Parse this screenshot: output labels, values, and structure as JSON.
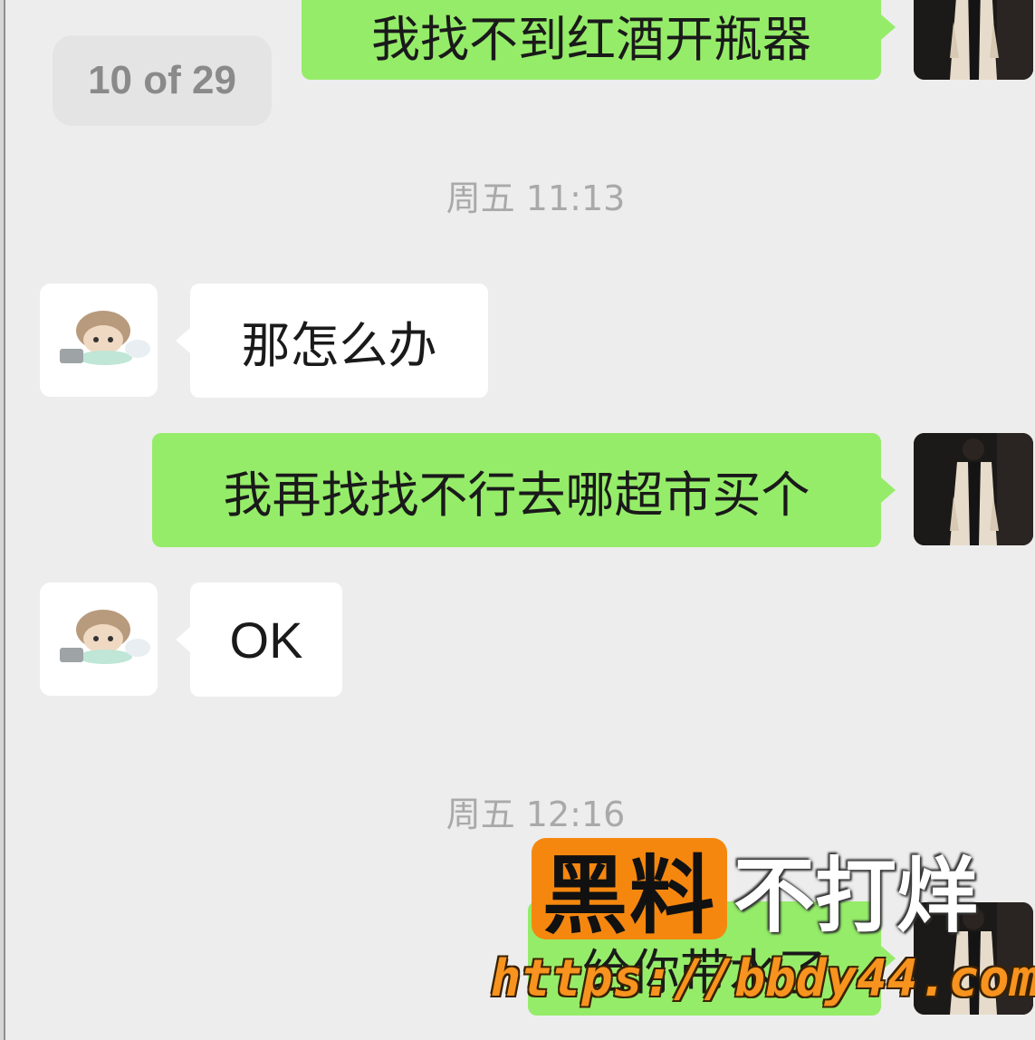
{
  "pager": {
    "label": "10 of 29"
  },
  "timestamps": [
    "周五 11:13",
    "周五 12:16"
  ],
  "messages": [
    {
      "side": "right",
      "text": "我找不到红酒开瓶器"
    },
    {
      "side": "left",
      "text": "那怎么办"
    },
    {
      "side": "right",
      "text": "我再找找不行去哪超市买个"
    },
    {
      "side": "left",
      "text": "OK"
    },
    {
      "side": "right",
      "text": "给你带水了"
    }
  ],
  "watermark": {
    "brand_highlight": "黑料",
    "brand_rest": "不打烊",
    "url": "https://bbdy44.com"
  },
  "colors": {
    "background": "#ededed",
    "sent_bubble": "#95ec69",
    "received_bubble": "#ffffff",
    "timestamp_text": "#a9a9a9",
    "watermark_orange": "#f5870f"
  },
  "icons": {
    "friend_avatar": "cartoon-avatar-icon",
    "my_avatar": "person-photo-avatar-icon"
  }
}
